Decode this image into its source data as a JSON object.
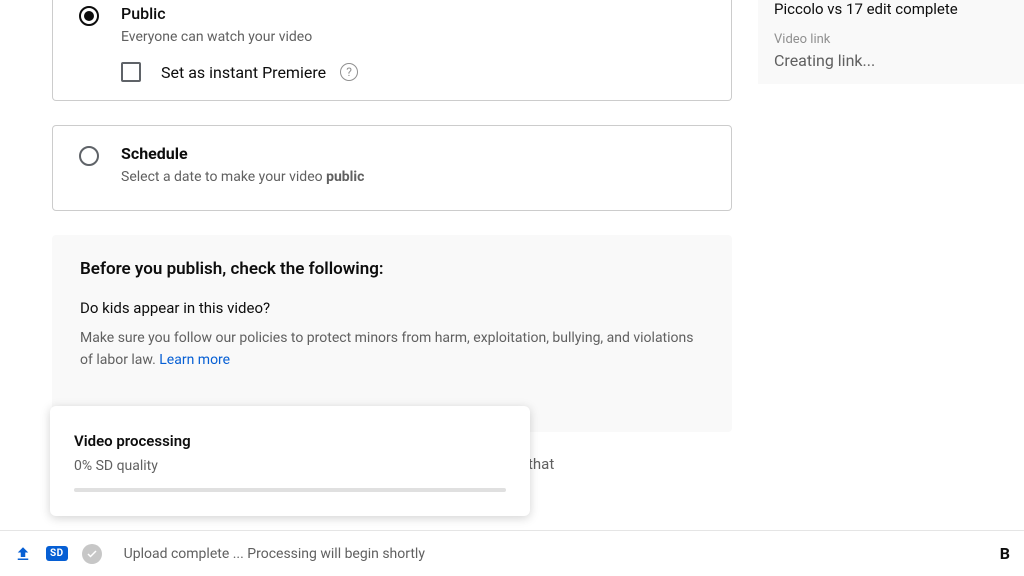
{
  "visibility": {
    "public": {
      "label": "Public",
      "desc": "Everyone can watch your video",
      "premiere_label": "Set as instant Premiere"
    },
    "schedule": {
      "label": "Schedule",
      "desc_pre": "Select a date to make your video ",
      "desc_bold": "public"
    }
  },
  "notice": {
    "heading": "Before you publish, check the following:",
    "question": "Do kids appear in this video?",
    "body": "Make sure you follow our policies to protect minors from harm, exploitation, bullying, and violations of labor law. ",
    "learn_more": "Learn more",
    "orphan": "that"
  },
  "processing": {
    "title": "Video processing",
    "status": "0% SD quality"
  },
  "sidebar": {
    "title": "Piccolo vs 17 edit complete",
    "link_label": "Video link",
    "link_value": "Creating link..."
  },
  "footer": {
    "sd_label": "SD",
    "status": "Upload complete ... Processing will begin shortly",
    "right": "B"
  }
}
